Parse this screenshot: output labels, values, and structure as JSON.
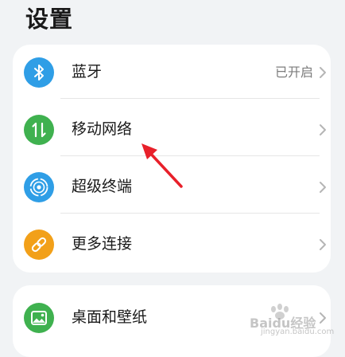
{
  "header": {
    "title": "设置"
  },
  "groups": [
    {
      "items": [
        {
          "label": "蓝牙",
          "value": "已开启",
          "icon": "bluetooth-icon",
          "icon_color": "#2f9ee6"
        },
        {
          "label": "移动网络",
          "value": "",
          "icon": "mobile-data-icon",
          "icon_color": "#3fb14f"
        },
        {
          "label": "超级终端",
          "value": "",
          "icon": "super-device-icon",
          "icon_color": "#2f9ee6"
        },
        {
          "label": "更多连接",
          "value": "",
          "icon": "link-icon",
          "icon_color": "#f2a019"
        }
      ]
    },
    {
      "items": [
        {
          "label": "桌面和壁纸",
          "value": "",
          "icon": "wallpaper-icon",
          "icon_color": "#3fb14f"
        }
      ]
    }
  ],
  "annotation": {
    "arrow_color": "#e8202a"
  },
  "watermark": {
    "brand": "Baidu经验",
    "sub": "jingyan.baidu.com"
  }
}
